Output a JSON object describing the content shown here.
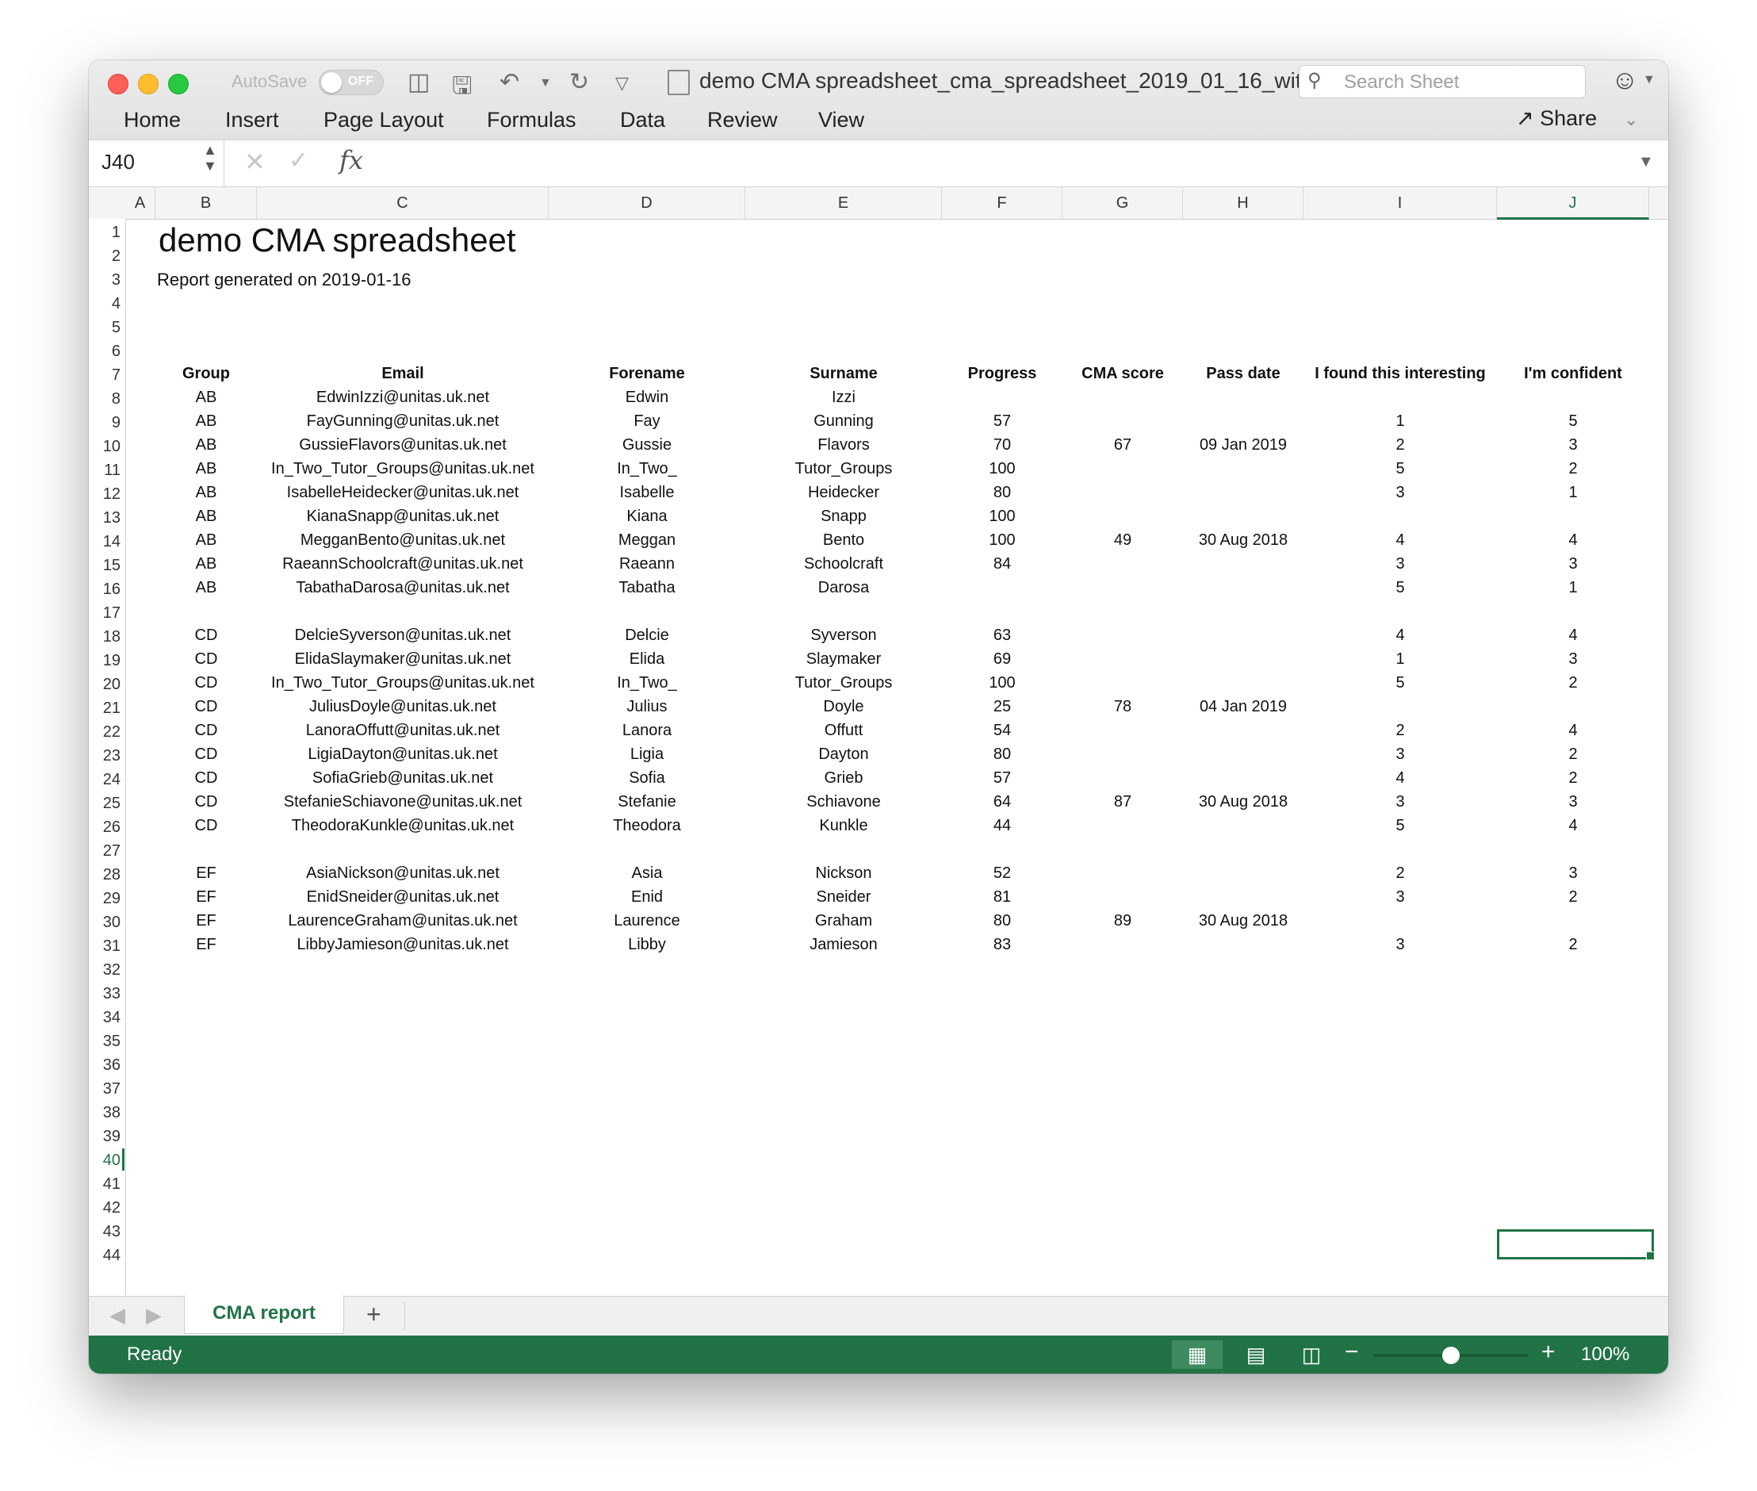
{
  "titlebar": {
    "autosave_label": "AutoSave",
    "autosave_state": "OFF",
    "doc_title": "demo CMA spreadsheet_cma_spreadsheet_2019_01_16_wit...",
    "search_placeholder": "Search Sheet"
  },
  "ribbon": {
    "tabs": [
      "Home",
      "Insert",
      "Page Layout",
      "Formulas",
      "Data",
      "Review",
      "View"
    ],
    "share_label": "Share"
  },
  "formula_bar": {
    "name_box": "J40",
    "fx_label": "fx",
    "formula": ""
  },
  "grid": {
    "columns": [
      "A",
      "B",
      "C",
      "D",
      "E",
      "F",
      "G",
      "H",
      "I",
      "J"
    ],
    "active_column": "J",
    "active_row": 40,
    "row_count": 44
  },
  "sheet": {
    "title": "demo CMA spreadsheet",
    "subtitle": "Report generated on 2019-01-16",
    "headers": [
      "Group",
      "Email",
      "Forename",
      "Surname",
      "Progress",
      "CMA score",
      "Pass date",
      "I found this interesting",
      "I'm confident"
    ],
    "rows": [
      {
        "row": 8,
        "cells": [
          "AB",
          "EdwinIzzi@unitas.uk.net",
          "Edwin",
          "Izzi",
          "",
          "",
          "",
          "",
          ""
        ]
      },
      {
        "row": 9,
        "cells": [
          "AB",
          "FayGunning@unitas.uk.net",
          "Fay",
          "Gunning",
          "57",
          "",
          "",
          "1",
          "5"
        ]
      },
      {
        "row": 10,
        "cells": [
          "AB",
          "GussieFlavors@unitas.uk.net",
          "Gussie",
          "Flavors",
          "70",
          "67",
          "09 Jan 2019",
          "2",
          "3"
        ]
      },
      {
        "row": 11,
        "cells": [
          "AB",
          "In_Two_Tutor_Groups@unitas.uk.net",
          "In_Two_",
          "Tutor_Groups",
          "100",
          "",
          "",
          "5",
          "2"
        ]
      },
      {
        "row": 12,
        "cells": [
          "AB",
          "IsabelleHeidecker@unitas.uk.net",
          "Isabelle",
          "Heidecker",
          "80",
          "",
          "",
          "3",
          "1"
        ]
      },
      {
        "row": 13,
        "cells": [
          "AB",
          "KianaSnapp@unitas.uk.net",
          "Kiana",
          "Snapp",
          "100",
          "",
          "",
          "",
          ""
        ]
      },
      {
        "row": 14,
        "cells": [
          "AB",
          "MegganBento@unitas.uk.net",
          "Meggan",
          "Bento",
          "100",
          "49",
          "30 Aug 2018",
          "4",
          "4"
        ]
      },
      {
        "row": 15,
        "cells": [
          "AB",
          "RaeannSchoolcraft@unitas.uk.net",
          "Raeann",
          "Schoolcraft",
          "84",
          "",
          "",
          "3",
          "3"
        ]
      },
      {
        "row": 16,
        "cells": [
          "AB",
          "TabathaDarosa@unitas.uk.net",
          "Tabatha",
          "Darosa",
          "",
          "",
          "",
          "5",
          "1"
        ]
      },
      {
        "row": 18,
        "cells": [
          "CD",
          "DelcieSyverson@unitas.uk.net",
          "Delcie",
          "Syverson",
          "63",
          "",
          "",
          "4",
          "4"
        ]
      },
      {
        "row": 19,
        "cells": [
          "CD",
          "ElidaSlaymaker@unitas.uk.net",
          "Elida",
          "Slaymaker",
          "69",
          "",
          "",
          "1",
          "3"
        ]
      },
      {
        "row": 20,
        "cells": [
          "CD",
          "In_Two_Tutor_Groups@unitas.uk.net",
          "In_Two_",
          "Tutor_Groups",
          "100",
          "",
          "",
          "5",
          "2"
        ]
      },
      {
        "row": 21,
        "cells": [
          "CD",
          "JuliusDoyle@unitas.uk.net",
          "Julius",
          "Doyle",
          "25",
          "78",
          "04 Jan 2019",
          "",
          ""
        ]
      },
      {
        "row": 22,
        "cells": [
          "CD",
          "LanoraOffutt@unitas.uk.net",
          "Lanora",
          "Offutt",
          "54",
          "",
          "",
          "2",
          "4"
        ]
      },
      {
        "row": 23,
        "cells": [
          "CD",
          "LigiaDayton@unitas.uk.net",
          "Ligia",
          "Dayton",
          "80",
          "",
          "",
          "3",
          "2"
        ]
      },
      {
        "row": 24,
        "cells": [
          "CD",
          "SofiaGrieb@unitas.uk.net",
          "Sofia",
          "Grieb",
          "57",
          "",
          "",
          "4",
          "2"
        ]
      },
      {
        "row": 25,
        "cells": [
          "CD",
          "StefanieSchiavone@unitas.uk.net",
          "Stefanie",
          "Schiavone",
          "64",
          "87",
          "30 Aug 2018",
          "3",
          "3"
        ]
      },
      {
        "row": 26,
        "cells": [
          "CD",
          "TheodoraKunkle@unitas.uk.net",
          "Theodora",
          "Kunkle",
          "44",
          "",
          "",
          "5",
          "4"
        ]
      },
      {
        "row": 28,
        "cells": [
          "EF",
          "AsiaNickson@unitas.uk.net",
          "Asia",
          "Nickson",
          "52",
          "",
          "",
          "2",
          "3"
        ]
      },
      {
        "row": 29,
        "cells": [
          "EF",
          "EnidSneider@unitas.uk.net",
          "Enid",
          "Sneider",
          "81",
          "",
          "",
          "3",
          "2"
        ]
      },
      {
        "row": 30,
        "cells": [
          "EF",
          "LaurenceGraham@unitas.uk.net",
          "Laurence",
          "Graham",
          "80",
          "89",
          "30 Aug 2018",
          "",
          ""
        ]
      },
      {
        "row": 31,
        "cells": [
          "EF",
          "LibbyJamieson@unitas.uk.net",
          "Libby",
          "Jamieson",
          "83",
          "",
          "",
          "3",
          "2"
        ]
      }
    ]
  },
  "sheet_tabs": {
    "active": "CMA report"
  },
  "status_bar": {
    "status": "Ready",
    "zoom": "100%",
    "zoom_level_percent": 100,
    "view_icons": [
      "normal-view-icon",
      "page-layout-view-icon",
      "page-break-view-icon"
    ]
  },
  "colors": {
    "accent": "#217346"
  }
}
